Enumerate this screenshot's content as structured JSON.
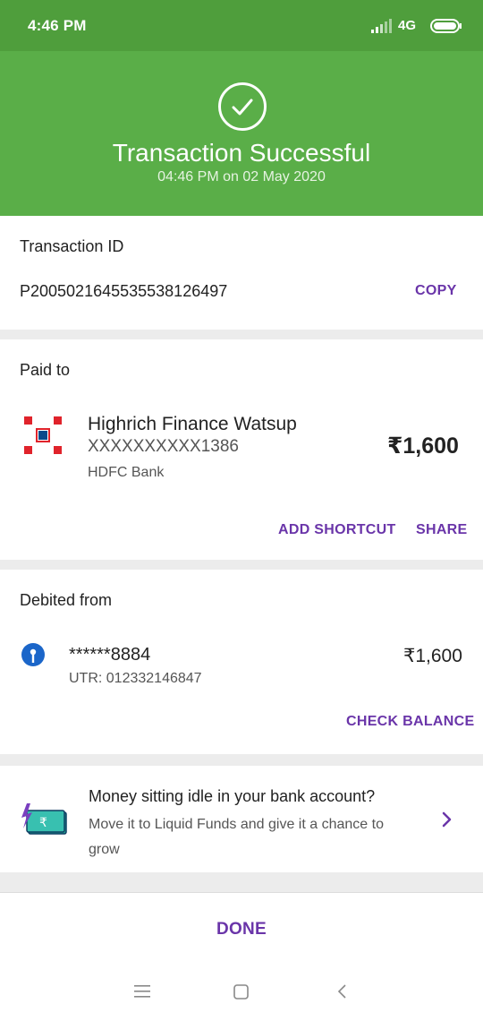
{
  "status_bar": {
    "time": "4:46 PM",
    "network": "4G"
  },
  "header": {
    "title": "Transaction Successful",
    "subtitle": "04:46 PM on 02 May 2020"
  },
  "transaction": {
    "label": "Transaction ID",
    "id": "P2005021645535538126497",
    "copy_label": "COPY"
  },
  "paid_to": {
    "label": "Paid to",
    "name": "Highrich Finance Watsup",
    "account": "XXXXXXXXXX1386",
    "bank": "HDFC Bank",
    "amount": "₹1,600",
    "add_shortcut_label": "ADD SHORTCUT",
    "share_label": "SHARE"
  },
  "debited_from": {
    "label": "Debited from",
    "account": "******8884",
    "utr": "UTR: 012332146847",
    "amount": "₹1,600",
    "check_balance_label": "CHECK BALANCE"
  },
  "promo": {
    "title": "Money sitting idle in your bank account?",
    "body": "Move it to Liquid Funds and give it a chance to grow"
  },
  "done_label": "DONE",
  "colors": {
    "header": "#5aae48",
    "statusbar": "#4f9e3c",
    "accent": "#6a35a9"
  }
}
